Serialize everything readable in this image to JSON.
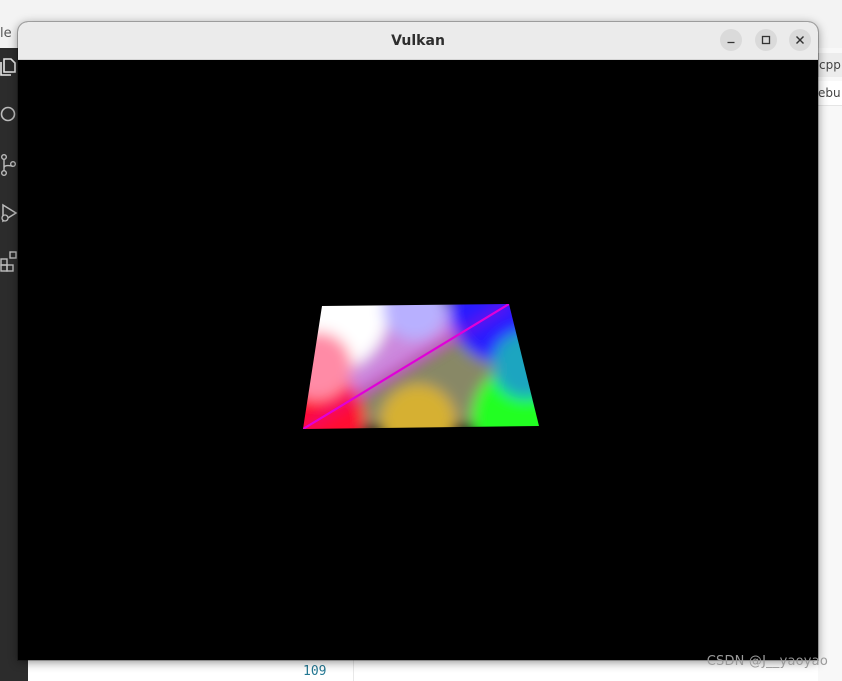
{
  "window": {
    "title": "Vulkan"
  },
  "background": {
    "topbar_partial_text": "le",
    "right_tab_1": "cpp",
    "right_tab_2": "ebu",
    "line_number": "109"
  },
  "watermark": "CSDN @J__yaoyao",
  "icons": {
    "activity": [
      "explorer-icon",
      "search-icon",
      "source-control-icon",
      "run-debug-icon",
      "extensions-icon"
    ],
    "window_controls": [
      "minimize-icon",
      "maximize-icon",
      "close-icon"
    ]
  },
  "scene": {
    "background_color": "#000000",
    "vertex_colors": {
      "top_left": "#ffffff",
      "top_right": "#0000ff",
      "bottom_left": "#ff0000",
      "bottom_right": "#00ff00"
    }
  }
}
